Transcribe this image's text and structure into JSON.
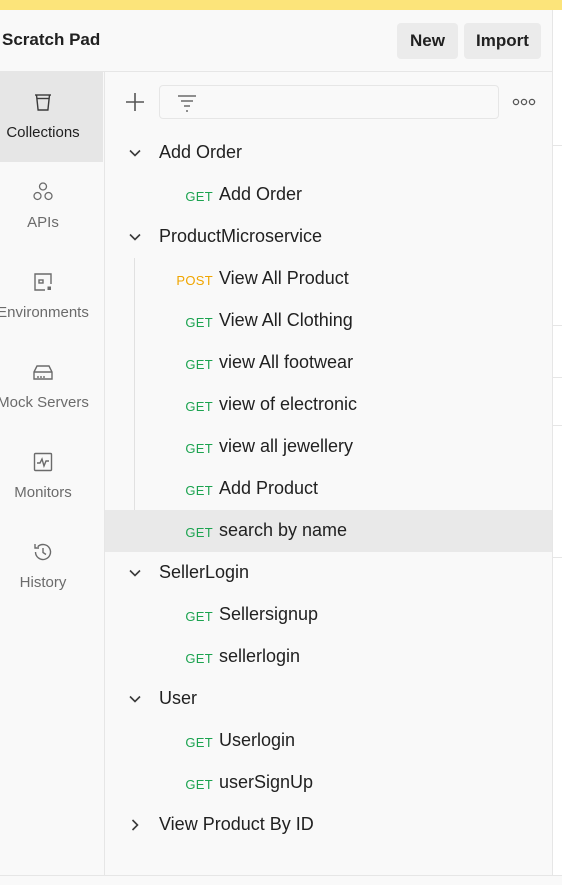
{
  "header": {
    "title": "Scratch Pad",
    "new_label": "New",
    "import_label": "Import"
  },
  "sidebar": {
    "items": [
      {
        "label": "Collections",
        "icon": "collections-icon",
        "active": true
      },
      {
        "label": "APIs",
        "icon": "apis-icon"
      },
      {
        "label": "Environments",
        "icon": "environments-icon"
      },
      {
        "label": "Mock Servers",
        "icon": "mock-servers-icon"
      },
      {
        "label": "Monitors",
        "icon": "monitors-icon"
      },
      {
        "label": "History",
        "icon": "history-icon"
      }
    ]
  },
  "toolbar": {
    "filter_placeholder": ""
  },
  "tree": [
    {
      "type": "folder",
      "name": "Add Order",
      "expanded": true
    },
    {
      "type": "request",
      "method": "GET",
      "name": "Add Order"
    },
    {
      "type": "folder",
      "name": "ProductMicroservice",
      "expanded": true
    },
    {
      "type": "request",
      "method": "POST",
      "name": "View All Product"
    },
    {
      "type": "request",
      "method": "GET",
      "name": "View All Clothing"
    },
    {
      "type": "request",
      "method": "GET",
      "name": "view All footwear"
    },
    {
      "type": "request",
      "method": "GET",
      "name": "view of electronic"
    },
    {
      "type": "request",
      "method": "GET",
      "name": "view all jewellery"
    },
    {
      "type": "request",
      "method": "GET",
      "name": "Add Product"
    },
    {
      "type": "request",
      "method": "GET",
      "name": "search by name",
      "selected": true
    },
    {
      "type": "folder",
      "name": "SellerLogin",
      "expanded": true
    },
    {
      "type": "request",
      "method": "GET",
      "name": "Sellersignup"
    },
    {
      "type": "request",
      "method": "GET",
      "name": "sellerlogin"
    },
    {
      "type": "folder",
      "name": "User",
      "expanded": true
    },
    {
      "type": "request",
      "method": "GET",
      "name": "Userlogin"
    },
    {
      "type": "request",
      "method": "GET",
      "name": "userSignUp"
    },
    {
      "type": "folder",
      "name": "View Product By ID",
      "expanded": false
    }
  ],
  "colors": {
    "get": "#1ca350",
    "post": "#f0a500",
    "accent_strip": "#fce47a"
  }
}
